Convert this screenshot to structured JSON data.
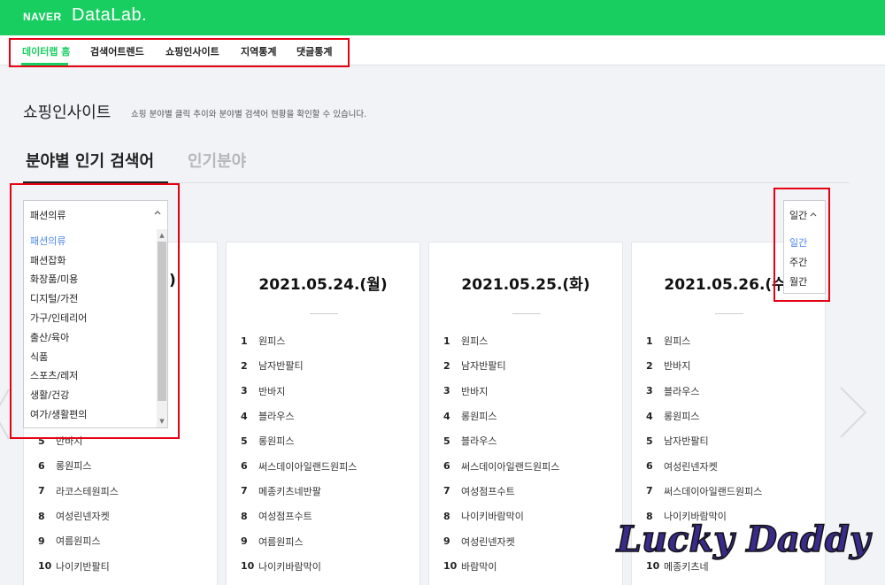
{
  "header": {
    "brand_naver": "NAVER",
    "brand_datalab": "DataLab."
  },
  "nav": [
    {
      "label": "데이터랩 홈",
      "active": true
    },
    {
      "label": "검색어트렌드",
      "active": false
    },
    {
      "label": "쇼핑인사이트",
      "active": false
    },
    {
      "label": "지역통계",
      "active": false
    },
    {
      "label": "댓글통계",
      "active": false
    }
  ],
  "page": {
    "title": "쇼핑인사이트",
    "description": "쇼핑 분야별 클릭 추이와 분야별 검색어 현황을 확인할 수 있습니다."
  },
  "tabs": [
    {
      "label": "분야별 인기 검색어",
      "active": true
    },
    {
      "label": "인기분야",
      "active": false
    }
  ],
  "category_dropdown": {
    "selected": "패션의류",
    "options": [
      "패션의류",
      "패션잡화",
      "화장품/미용",
      "디지털/가전",
      "가구/인테리어",
      "출산/육아",
      "식품",
      "스포츠/레저",
      "생활/건강",
      "여가/생활편의"
    ]
  },
  "period_dropdown": {
    "selected": "일간",
    "options": [
      "일간",
      "주간",
      "월간"
    ]
  },
  "cards": [
    {
      "date": ")",
      "ranks": [
        {
          "no": "5",
          "kw": "반바지"
        },
        {
          "no": "6",
          "kw": "롱원피스"
        },
        {
          "no": "7",
          "kw": "라코스테원피스"
        },
        {
          "no": "8",
          "kw": "여성린넨자켓"
        },
        {
          "no": "9",
          "kw": "여름원피스"
        },
        {
          "no": "10",
          "kw": "나이키반팔티"
        }
      ]
    },
    {
      "date": "2021.05.24.(월)",
      "ranks": [
        {
          "no": "1",
          "kw": "원피스"
        },
        {
          "no": "2",
          "kw": "남자반팔티"
        },
        {
          "no": "3",
          "kw": "반바지"
        },
        {
          "no": "4",
          "kw": "블라우스"
        },
        {
          "no": "5",
          "kw": "롱원피스"
        },
        {
          "no": "6",
          "kw": "써스데이아일랜드원피스"
        },
        {
          "no": "7",
          "kw": "메종키츠네반팔"
        },
        {
          "no": "8",
          "kw": "여성점프수트"
        },
        {
          "no": "9",
          "kw": "여름원피스"
        },
        {
          "no": "10",
          "kw": "나이키바람막이"
        }
      ]
    },
    {
      "date": "2021.05.25.(화)",
      "ranks": [
        {
          "no": "1",
          "kw": "원피스"
        },
        {
          "no": "2",
          "kw": "남자반팔티"
        },
        {
          "no": "3",
          "kw": "반바지"
        },
        {
          "no": "4",
          "kw": "롱원피스"
        },
        {
          "no": "5",
          "kw": "블라우스"
        },
        {
          "no": "6",
          "kw": "써스데이아일랜드원피스"
        },
        {
          "no": "7",
          "kw": "여성점프수트"
        },
        {
          "no": "8",
          "kw": "나이키바람막이"
        },
        {
          "no": "9",
          "kw": "여성린넨자켓"
        },
        {
          "no": "10",
          "kw": "바람막이"
        }
      ]
    },
    {
      "date": "2021.05.26.(수)",
      "ranks": [
        {
          "no": "1",
          "kw": "원피스"
        },
        {
          "no": "2",
          "kw": "반바지"
        },
        {
          "no": "3",
          "kw": "블라우스"
        },
        {
          "no": "4",
          "kw": "롱원피스"
        },
        {
          "no": "5",
          "kw": "남자반팔티"
        },
        {
          "no": "6",
          "kw": "여성린넨자켓"
        },
        {
          "no": "7",
          "kw": "써스데이아일랜드원피스"
        },
        {
          "no": "8",
          "kw": "나이키바람막이"
        },
        {
          "no": "9",
          "kw": ""
        },
        {
          "no": "10",
          "kw": "메종키츠네"
        }
      ]
    }
  ],
  "watermark": {
    "text": "Lucky Daddy"
  },
  "colors": {
    "brand_green": "#19ce60",
    "highlight_red": "#e60012",
    "selected_blue": "#4a86e8"
  },
  "icons": {
    "chevron_up": "chevron-up-icon",
    "prev": "chevron-left-icon",
    "next": "chevron-right-icon"
  }
}
